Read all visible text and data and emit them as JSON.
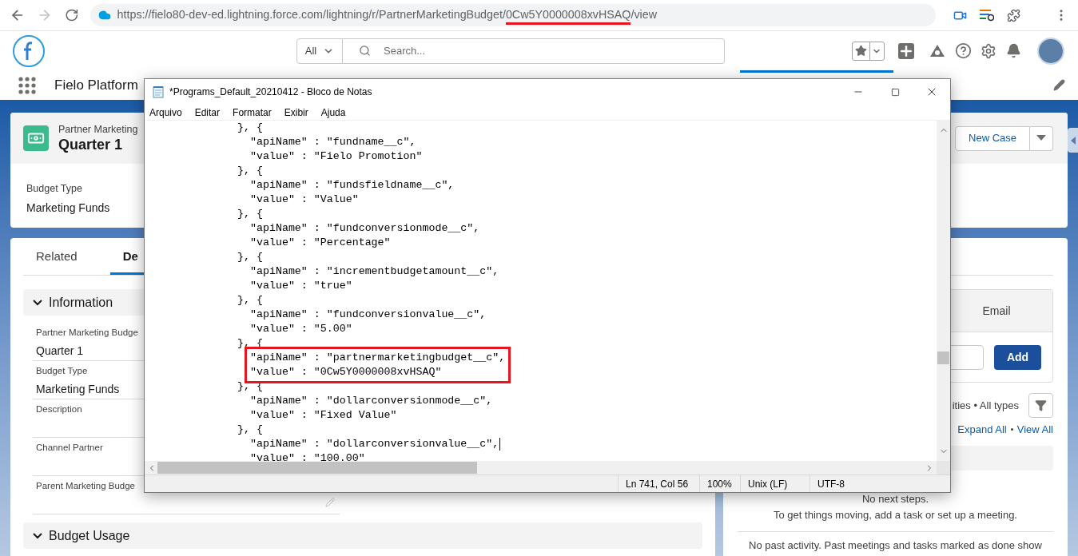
{
  "browser": {
    "url_parts": [
      {
        "text": "https://fielo80-dev-ed.lightning.force.com/lightning/r/PartnerMarketingBudget/",
        "highlighted": false
      },
      {
        "text": "0Cw5Y0000008xvHSAQ",
        "highlighted": true
      },
      {
        "text": "/view",
        "highlighted": false
      }
    ]
  },
  "header": {
    "search_scope": "All",
    "search_placeholder": "Search..."
  },
  "nav": {
    "app_name": "Fielo Platform"
  },
  "record": {
    "object_label": "Partner Marketing",
    "title": "Quarter 1",
    "highlights": [
      {
        "label": "Budget Type",
        "value": "Marketing Funds"
      }
    ],
    "actions": [
      "New Case"
    ]
  },
  "detail_tabs": [
    {
      "label": "Related",
      "selected": false
    },
    {
      "label": "De",
      "selected": true
    }
  ],
  "sections": [
    {
      "title": "Information",
      "expanded": true,
      "fields": [
        {
          "label": "Partner Marketing Budge",
          "value": "Quarter 1"
        },
        {
          "label": "Budget Type",
          "value": "Marketing Funds"
        },
        {
          "label": "Description"
        },
        {
          "label": "Channel Partner"
        },
        {
          "label": "Parent Marketing Budge"
        }
      ]
    },
    {
      "title": "Budget Usage",
      "expanded": true
    }
  ],
  "activity": {
    "tabs": [
      "Email"
    ],
    "add_button": "Add",
    "filter_text": "ities • All types",
    "links": [
      "Expand All",
      "View All"
    ],
    "next_steps": "No next steps.",
    "next_steps_hint": "To get things moving, add a task or set up a meeting.",
    "past_activity": "No past activity. Past meetings and tasks marked as done show"
  },
  "notepad": {
    "title": "*Programs_Default_20210412 - Bloco de Notas",
    "menu": [
      "Arquivo",
      "Editar",
      "Formatar",
      "Exibir",
      "Ajuda"
    ],
    "lines": [
      {
        "kind": "brace",
        "text": "}, {"
      },
      {
        "kind": "property",
        "text": "\"apiName\" : \"fundname__c\","
      },
      {
        "kind": "property",
        "text": "\"value\" : \"Fielo Promotion\""
      },
      {
        "kind": "brace",
        "text": "}, {"
      },
      {
        "kind": "property",
        "text": "\"apiName\" : \"fundsfieldname__c\","
      },
      {
        "kind": "property",
        "text": "\"value\" : \"Value\""
      },
      {
        "kind": "brace",
        "text": "}, {"
      },
      {
        "kind": "property",
        "text": "\"apiName\" : \"fundconversionmode__c\","
      },
      {
        "kind": "property",
        "text": "\"value\" : \"Percentage\""
      },
      {
        "kind": "brace",
        "text": "}, {"
      },
      {
        "kind": "property",
        "text": "\"apiName\" : \"incrementbudgetamount__c\","
      },
      {
        "kind": "property",
        "text": "\"value\" : \"true\""
      },
      {
        "kind": "brace",
        "text": "}, {"
      },
      {
        "kind": "property",
        "text": "\"apiName\" : \"fundconversionvalue__c\","
      },
      {
        "kind": "property",
        "text": "\"value\" : \"5.00\""
      },
      {
        "kind": "brace",
        "text": "}, {"
      },
      {
        "kind": "boxed",
        "lines": [
          {
            "kind": "property",
            "text": "\"apiName\" : \"partnermarketingbudget__c\","
          },
          {
            "kind": "property",
            "text": "\"value\" : \"0Cw5Y0000008xvHSAQ\""
          }
        ]
      },
      {
        "kind": "brace",
        "text": "}, {"
      },
      {
        "kind": "property",
        "text": "\"apiName\" : \"dollarconversionmode__c\","
      },
      {
        "kind": "property",
        "text": "\"value\" : \"Fixed Value\""
      },
      {
        "kind": "brace",
        "text": "}, {"
      },
      {
        "kind": "caret",
        "text": "\"apiName\" : \"dollarconversionvalue__c\","
      },
      {
        "kind": "property",
        "text": "\"value\" : \"100.00\""
      }
    ],
    "status": [
      "Ln 741, Col 56",
      "100%",
      "Unix (LF)",
      "UTF-8"
    ]
  }
}
